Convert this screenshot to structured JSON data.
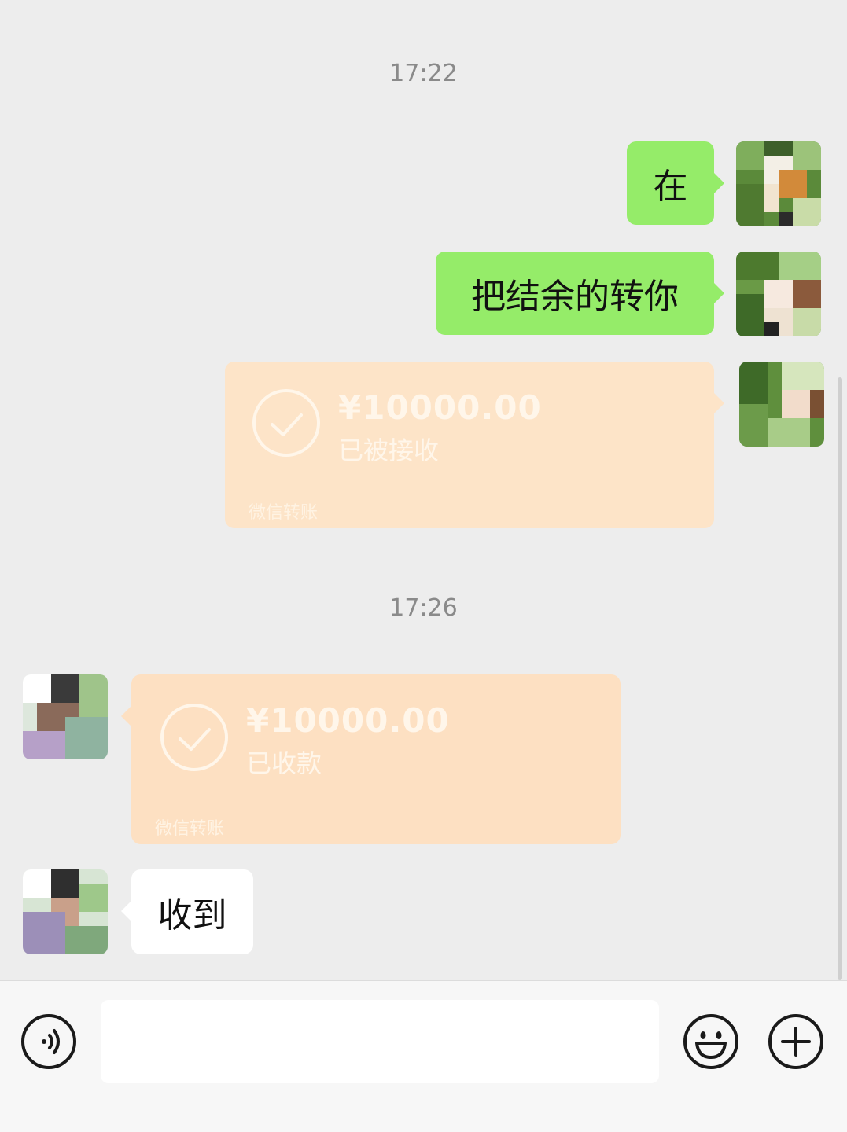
{
  "chat": {
    "timestamps": [
      "17:22",
      "17:26"
    ],
    "sent_messages": [
      "在",
      "把结余的转你"
    ],
    "sent_transfer": {
      "amount": "¥10000.00",
      "status": "已被接收",
      "footer": "微信转账"
    },
    "received_transfer": {
      "amount": "¥10000.00",
      "status": "已收款",
      "footer": "微信转账"
    },
    "received_messages": [
      "收到"
    ]
  },
  "input_bar": {
    "text_value": "",
    "icons": [
      "voice-icon",
      "emoji-icon",
      "plus-icon"
    ]
  },
  "colors": {
    "background": "#ededed",
    "sent_bubble": "#95ec69",
    "received_bubble": "#ffffff",
    "transfer_card": "#fde4c8"
  }
}
